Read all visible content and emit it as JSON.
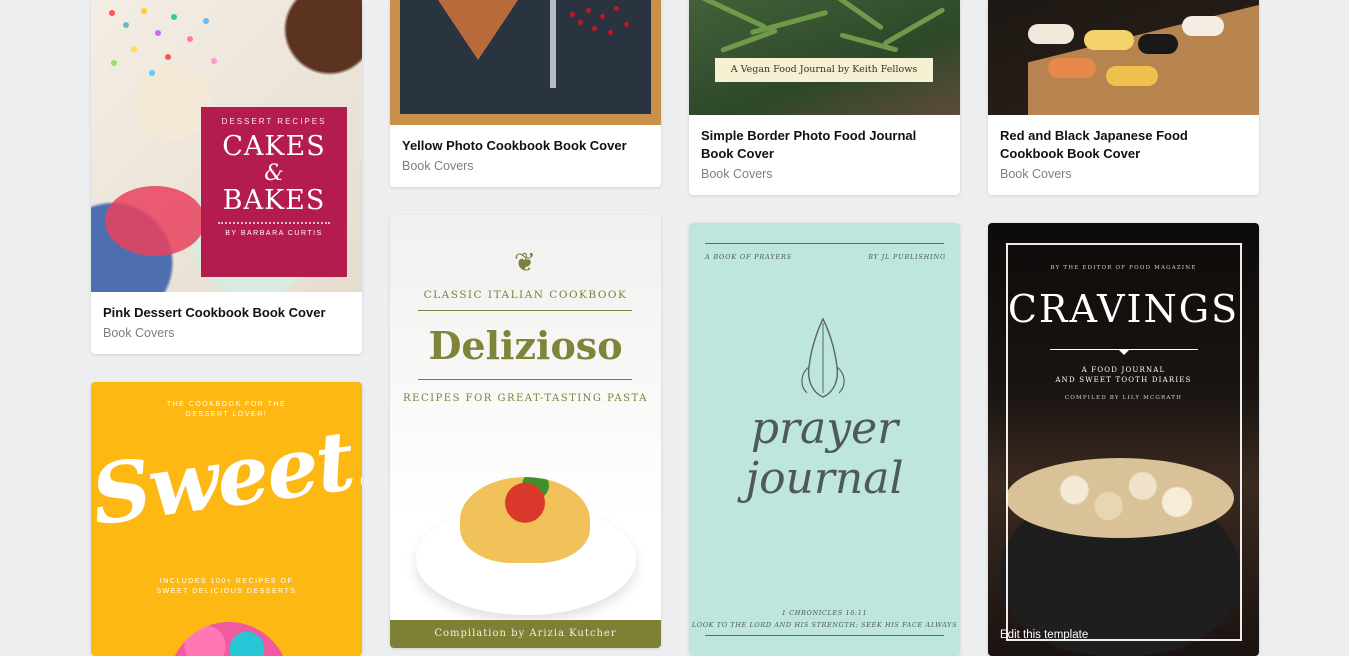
{
  "cards": [
    {
      "title": "Pink Dessert Cookbook Book Cover",
      "category": "Book Covers"
    },
    {
      "title": "Yellow Photo Cookbook Book Cover",
      "category": "Book Covers"
    },
    {
      "title": "Simple Border Photo Food Journal Book Cover",
      "category": "Book Covers"
    },
    {
      "title": "Red and Black Japanese Food Cookbook Book Cover",
      "category": "Book Covers"
    }
  ],
  "covers": {
    "cakes": {
      "kicker": "DESSERT RECIPES",
      "line1": "CAKES",
      "amp": "&",
      "line2": "BAKES",
      "author": "BY BARBARA CURTIS"
    },
    "sweet": {
      "top1": "THE COOKBOOK FOR THE",
      "top2": "DESSERT LOVER!",
      "word": "Sweet!",
      "bottom1": "INCLUDES 100+ RECIPES OF",
      "bottom2": "SWEET DELICIOUS DESSERTS"
    },
    "delizioso": {
      "kicker": "CLASSIC ITALIAN COOKBOOK",
      "name": "Delizioso",
      "sub": "RECIPES FOR GREAT-TASTING PASTA",
      "band": "Compilation by Arizia Kutcher"
    },
    "vegan": {
      "label": "A Vegan Food Journal by Keith Fellows"
    },
    "prayer": {
      "left": "A BOOK OF PRAYERS",
      "right": "BY JL PUBLISHING",
      "word1": "prayer",
      "word2": "journal",
      "cite1": "1 CHRONICLES 16:11",
      "cite2": "LOOK TO THE LORD AND HIS STRENGTH; SEEK HIS FACE ALWAYS"
    },
    "cravings": {
      "top": "BY THE EDITOR OF FOOD MAGAZINE",
      "title": "CRAVINGS",
      "sub1": "A FOOD JOURNAL",
      "sub2": "AND SWEET TOOTH DIARIES",
      "compiled": "COMPILED BY LILY MCGRATH",
      "edit": "Edit this template"
    }
  },
  "colors": {
    "background": "#eceef0",
    "cakes_box": "#b31c4c",
    "sweet_bg": "#fdb813",
    "olive": "#7e8035",
    "mint": "#bfe5df"
  }
}
